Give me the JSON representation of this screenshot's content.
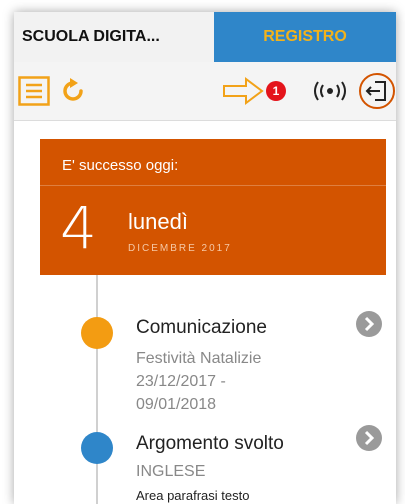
{
  "tabs": {
    "left": "SCUOLA DIGITA...",
    "right": "REGISTRO"
  },
  "toolbar": {
    "badge_count": "1"
  },
  "card": {
    "header": "E' successo oggi:",
    "day_number": "4",
    "day_name": "lunedì",
    "month_year": "DICEMBRE 2017"
  },
  "items": [
    {
      "title": "Comunicazione",
      "subtitle_lines": [
        "Festività Natalizie",
        "23/12/2017 -",
        "09/01/2018"
      ]
    },
    {
      "title": "Argomento svolto",
      "subtitle": "INGLESE",
      "note": "Area parafrasi testo"
    }
  ],
  "colors": {
    "accent_orange": "#d35400",
    "tab_blue": "#2f86c9",
    "tab_text_yellow": "#f2b21a",
    "dot_orange": "#f39c12",
    "dot_blue": "#2f86c9",
    "badge_red": "#e4141b"
  }
}
